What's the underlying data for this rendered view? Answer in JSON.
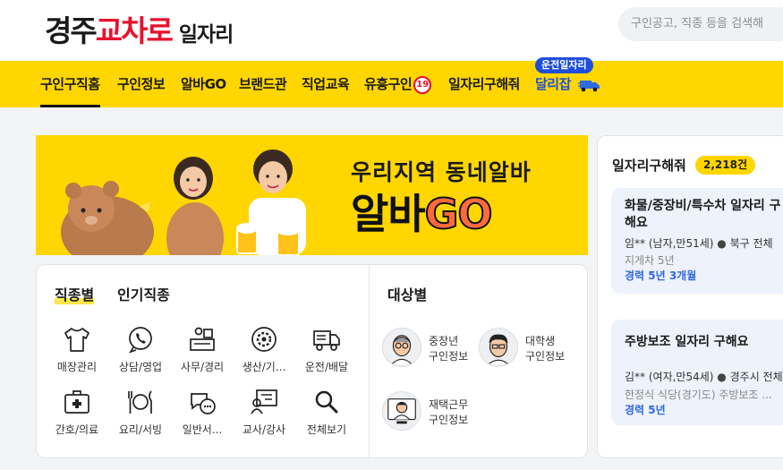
{
  "header": {
    "logo": {
      "city": "경주",
      "brand": "교차로",
      "sub": "일자리"
    },
    "search_placeholder": "구인공고, 직종 등을 검색해"
  },
  "nav": {
    "items": [
      "구인구직홈",
      "구인정보",
      "알바GO",
      "브랜드관",
      "직업교육",
      "유흥구인",
      "일자리구해줘",
      "달리잡"
    ],
    "badge": "19",
    "driver_tag": "운전일자리"
  },
  "banner": {
    "line1": "우리지역 동네알바",
    "line2_a": "알바",
    "line2_b": "GO"
  },
  "categories": {
    "tabs": [
      "직종별",
      "인기직종"
    ],
    "items": [
      {
        "label": "매장관리",
        "icon": "shirt-icon"
      },
      {
        "label": "상담/영업",
        "icon": "phone-icon"
      },
      {
        "label": "사무/경리",
        "icon": "office-desk-icon"
      },
      {
        "label": "생산/기...",
        "icon": "gear-icon"
      },
      {
        "label": "운전/배달",
        "icon": "truck-icon"
      },
      {
        "label": "간호/의료",
        "icon": "medical-kit-icon"
      },
      {
        "label": "요리/서빙",
        "icon": "cutlery-icon"
      },
      {
        "label": "일반서...",
        "icon": "chat-bubble-icon"
      },
      {
        "label": "교사/강사",
        "icon": "teacher-board-icon"
      },
      {
        "label": "전체보기",
        "icon": "search-icon"
      }
    ]
  },
  "targets": {
    "title": "대상별",
    "items": [
      {
        "line1": "중장년",
        "line2": "구인정보"
      },
      {
        "line1": "대학생",
        "line2": "구인정보"
      },
      {
        "line1": "재택근무",
        "line2": "구인정보"
      }
    ]
  },
  "jobseekers": {
    "title": "일자리구해줘",
    "count": "2,218건",
    "cards": [
      {
        "title": "화물/중장비/특수차 일자리 구해요",
        "person": "임** (남자,만51세)",
        "location": "북구 전체",
        "desc": "지게차 5년",
        "career": "경력 5년 3개월"
      },
      {
        "title": "주방보조 일자리 구해요",
        "person": "김** (여자,만54세)",
        "location": "경주시 전체",
        "desc": "한정식 식당(경기도) 주방보조 ...",
        "career": "경력 5년"
      }
    ]
  },
  "colors": {
    "accent_yellow": "#ffd600",
    "brand_red": "#e8112d",
    "link_blue": "#2f6ae0",
    "driver_blue": "#1f4fd8"
  }
}
